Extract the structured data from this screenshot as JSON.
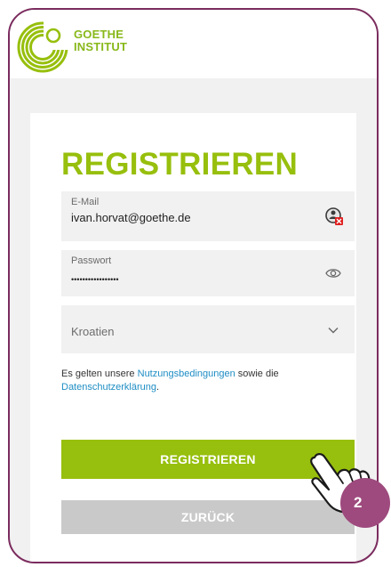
{
  "brand": {
    "line1": "GOETHE",
    "line2": "INSTITUT"
  },
  "form": {
    "title": "REGISTRIEREN",
    "email": {
      "label": "E-Mail",
      "value": "ivan.horvat@goethe.de"
    },
    "password": {
      "label": "Passwort",
      "value": "•••••••••••••••••"
    },
    "country": {
      "value": "Kroatien"
    },
    "legal": {
      "prefix": "Es gelten unsere ",
      "terms_link": "Nutzungsbedingungen",
      "middle": " sowie die ",
      "privacy_link": "Datenschutzerklärung",
      "suffix": "."
    },
    "register_button": "REGISTRIEREN",
    "back_button": "ZURÜCK"
  },
  "step_badge": "2",
  "colors": {
    "accent": "#97bf0d",
    "link": "#1e8dc4",
    "frame": "#7b2c5e",
    "badge": "#9e4a7e",
    "secondary_button": "#c9c9c9"
  },
  "icons": {
    "logo": "goethe-institut-logo",
    "email_field": "password-manager-icon",
    "password_field": "eye-icon",
    "country_field": "chevron-down-icon",
    "pointer": "pointing-hand-icon"
  }
}
